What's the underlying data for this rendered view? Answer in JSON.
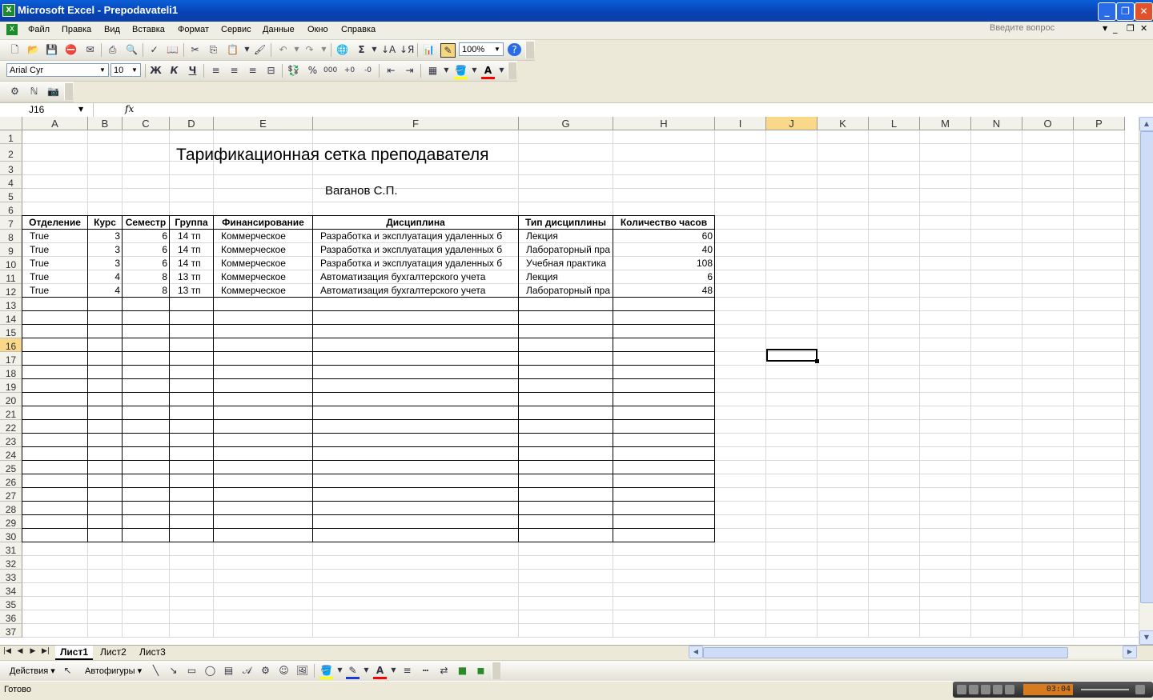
{
  "window": {
    "title": "Microsoft Excel - Prepodavateli1"
  },
  "menu": [
    "Файл",
    "Правка",
    "Вид",
    "Вставка",
    "Формат",
    "Сервис",
    "Данные",
    "Окно",
    "Справка"
  ],
  "ask_placeholder": "Введите вопрос",
  "toolbar": {
    "zoom": "100%",
    "font": "Arial Cyr",
    "font_size": "10",
    "bold": "Ж",
    "italic": "К",
    "underline": "Ч"
  },
  "formula_bar": {
    "cell_ref": "J16",
    "fx": "fx",
    "content": ""
  },
  "columns": [
    "A",
    "B",
    "C",
    "D",
    "E",
    "F",
    "G",
    "H",
    "I",
    "J",
    "K",
    "L",
    "M",
    "N",
    "O",
    "P"
  ],
  "rows": [
    "1",
    "2",
    "3",
    "4",
    "5",
    "6",
    "7",
    "8",
    "9",
    "10",
    "11",
    "12",
    "13",
    "14",
    "15",
    "16",
    "17",
    "18",
    "19",
    "20",
    "21",
    "22",
    "23",
    "24",
    "25",
    "26",
    "27",
    "28",
    "29",
    "30",
    "31",
    "32",
    "33",
    "34",
    "35",
    "36",
    "37"
  ],
  "sheet": {
    "title": "Тарификационная сетка преподавателя",
    "teacher": "Ваганов С.П.",
    "headers": [
      "Отделение",
      "Курс",
      "Семестр",
      "Группа",
      "Финансирование",
      "Дисциплина",
      "Тип дисциплины",
      "Количество часов"
    ],
    "data": [
      [
        "True",
        "3",
        "6",
        "14 тп",
        "Коммерческое",
        "Разработка и эксплуатация удаленных б",
        "Лекция",
        "60"
      ],
      [
        "True",
        "3",
        "6",
        "14 тп",
        "Коммерческое",
        "Разработка и эксплуатация удаленных б",
        "Лабораторный пра",
        "40"
      ],
      [
        "True",
        "3",
        "6",
        "14 тп",
        "Коммерческое",
        "Разработка и эксплуатация удаленных б",
        "Учебная практика",
        "108"
      ],
      [
        "True",
        "4",
        "8",
        "13 тп",
        "Коммерческое",
        "Автоматизация бухгалтерского учета",
        "Лекция",
        "6"
      ],
      [
        "True",
        "4",
        "8",
        "13 тп",
        "Коммерческое",
        "Автоматизация бухгалтерского учета",
        "Лабораторный пра",
        "48"
      ]
    ]
  },
  "tabs": [
    "Лист1",
    "Лист2",
    "Лист3"
  ],
  "drawing": {
    "actions": "Действия",
    "autoshapes": "Автофигуры"
  },
  "status": "Готово",
  "media_time": "03:04"
}
